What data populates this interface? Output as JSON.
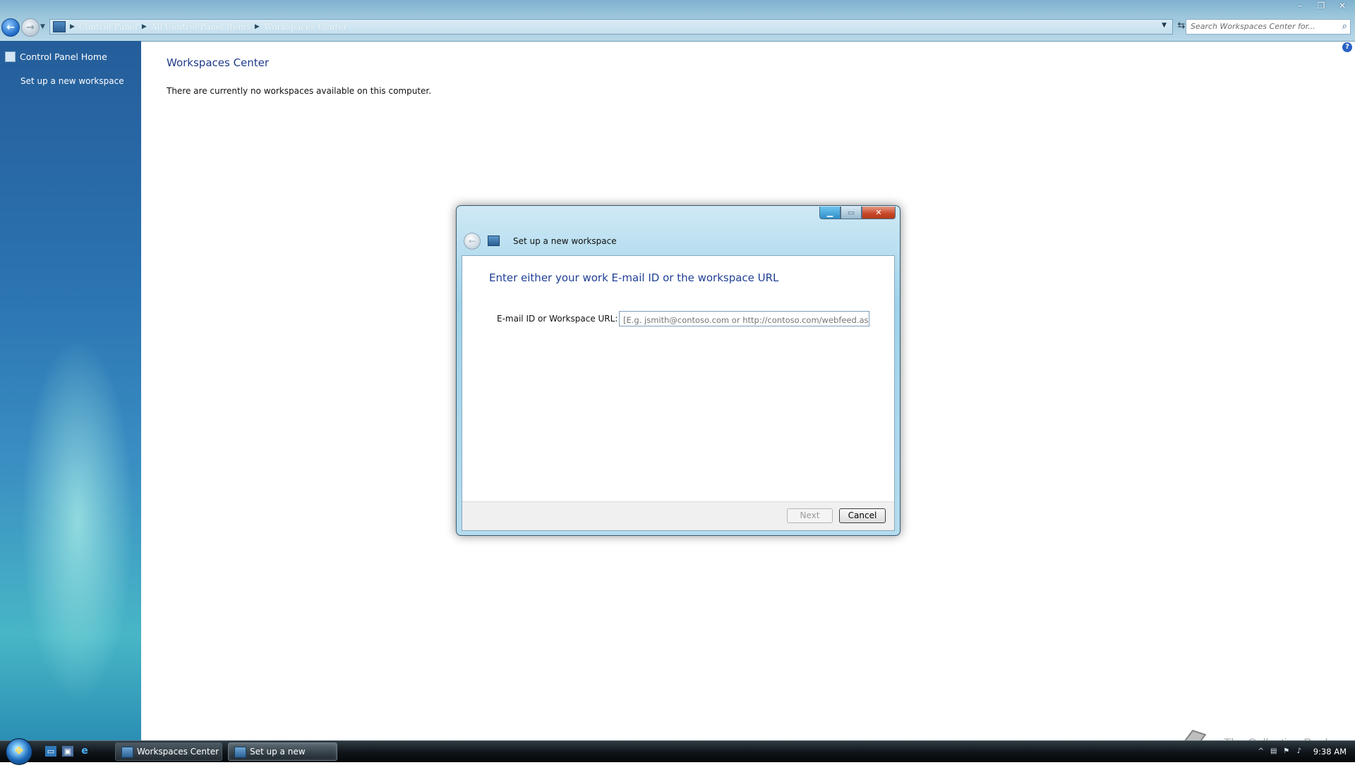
{
  "window": {
    "breadcrumb": [
      "Control Panel",
      "All Control Panel Items",
      "Workspaces Center"
    ],
    "search_placeholder": "Search Workspaces Center for...",
    "controls": {
      "minimize": "–",
      "maximize": "❐",
      "close": "✕"
    }
  },
  "sidebar": {
    "home_label": "Control Panel Home",
    "items": [
      {
        "label": "Set up a new workspace"
      }
    ]
  },
  "main": {
    "title": "Workspaces Center",
    "message": "There are currently no workspaces available on this computer."
  },
  "dialog": {
    "title": "Set up a new workspace",
    "heading": "Enter either your work E-mail ID or the workspace URL",
    "field_label": "E-mail ID or Workspace URL:",
    "field_placeholder": "[E.g. jsmith@contoso.com or http://contoso.com/webfeed.aspx]",
    "field_value": "",
    "next_label": "Next",
    "cancel_label": "Cancel"
  },
  "taskbar": {
    "windows": [
      {
        "label": "Workspaces Center"
      },
      {
        "label": "Set up a new works..."
      }
    ],
    "clock": "9:38 AM"
  },
  "watermark": {
    "text": "The Collection Book"
  },
  "colors": {
    "title_blue": "#1e3a8a",
    "sidebar_top": "#255e9a",
    "sidebar_bottom": "#48b6c6",
    "close_red": "#c74626"
  }
}
